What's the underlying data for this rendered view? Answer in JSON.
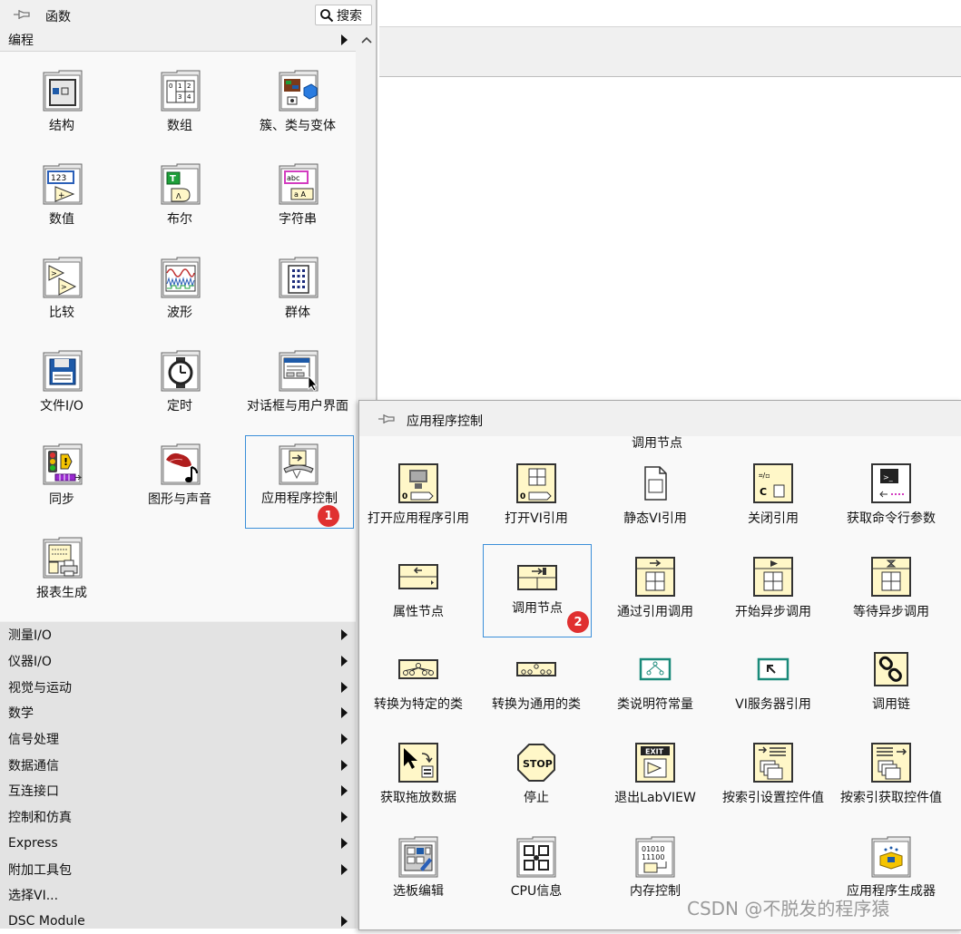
{
  "palette": {
    "title": "函数",
    "search_label": "搜索",
    "open_category": "编程",
    "items": [
      {
        "label": "结构",
        "icon": "structures-icon"
      },
      {
        "label": "数组",
        "icon": "array-icon"
      },
      {
        "label": "簇、类与变体",
        "icon": "cluster-class-variant-icon"
      },
      {
        "label": "数值",
        "icon": "numeric-icon"
      },
      {
        "label": "布尔",
        "icon": "boolean-icon"
      },
      {
        "label": "字符串",
        "icon": "string-icon"
      },
      {
        "label": "比较",
        "icon": "comparison-icon"
      },
      {
        "label": "波形",
        "icon": "waveform-icon"
      },
      {
        "label": "群体",
        "icon": "collection-icon"
      },
      {
        "label": "文件I/O",
        "icon": "file-io-icon"
      },
      {
        "label": "定时",
        "icon": "timing-icon"
      },
      {
        "label": "对话框与用户界面",
        "icon": "dialog-ui-icon"
      },
      {
        "label": "同步",
        "icon": "synchronization-icon"
      },
      {
        "label": "图形与声音",
        "icon": "graphics-sound-icon"
      },
      {
        "label": "应用程序控制",
        "icon": "application-control-icon"
      },
      {
        "label": "报表生成",
        "icon": "report-generation-icon"
      }
    ],
    "categories": [
      "测量I/O",
      "仪器I/O",
      "视觉与运动",
      "数学",
      "信号处理",
      "数据通信",
      "互连接口",
      "控制和仿真",
      "Express",
      "附加工具包",
      "选择VI...",
      "DSC Module"
    ]
  },
  "subpalette": {
    "title": "应用程序控制",
    "tooltip": "调用节点",
    "items": [
      {
        "label": "打开应用程序引用",
        "icon": "open-app-reference-icon"
      },
      {
        "label": "打开VI引用",
        "icon": "open-vi-reference-icon"
      },
      {
        "label": "静态VI引用",
        "icon": "static-vi-reference-icon"
      },
      {
        "label": "关闭引用",
        "icon": "close-reference-icon"
      },
      {
        "label": "获取命令行参数",
        "icon": "command-line-args-icon"
      },
      {
        "label": "属性节点",
        "icon": "property-node-icon"
      },
      {
        "label": "调用节点",
        "icon": "invoke-node-icon"
      },
      {
        "label": "通过引用调用",
        "icon": "call-by-reference-icon"
      },
      {
        "label": "开始异步调用",
        "icon": "start-async-call-icon"
      },
      {
        "label": "等待异步调用",
        "icon": "wait-async-call-icon"
      },
      {
        "label": "转换为特定的类",
        "icon": "to-more-specific-class-icon"
      },
      {
        "label": "转换为通用的类",
        "icon": "to-more-generic-class-icon"
      },
      {
        "label": "类说明符常量",
        "icon": "class-specifier-constant-icon"
      },
      {
        "label": "VI服务器引用",
        "icon": "vi-server-reference-icon"
      },
      {
        "label": "调用链",
        "icon": "call-chain-icon"
      },
      {
        "label": "获取拖放数据",
        "icon": "get-drag-drop-data-icon"
      },
      {
        "label": "停止",
        "icon": "stop-icon"
      },
      {
        "label": "退出LabVIEW",
        "icon": "quit-labview-icon"
      },
      {
        "label": "按索引设置控件值",
        "icon": "set-control-value-icon"
      },
      {
        "label": "按索引获取控件值",
        "icon": "get-control-value-icon"
      },
      {
        "label": "选板编辑",
        "icon": "palette-editing-icon"
      },
      {
        "label": "CPU信息",
        "icon": "cpu-info-icon"
      },
      {
        "label": "内存控制",
        "icon": "memory-control-icon"
      },
      {
        "label": "应用程序生成器",
        "icon": "application-builder-icon"
      }
    ]
  },
  "badges": [
    "1",
    "2"
  ],
  "watermark": "CSDN @不脱发的程序猿"
}
